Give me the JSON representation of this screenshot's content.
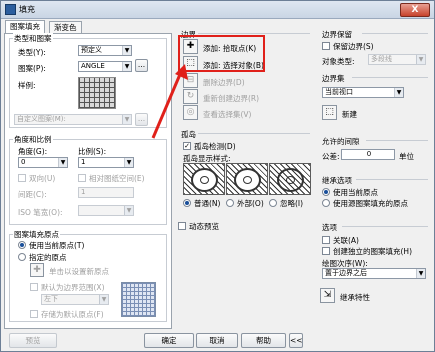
{
  "window": {
    "title": "填充",
    "close_label": "X"
  },
  "tabs": [
    "图案填充",
    "渐变色"
  ],
  "left": {
    "type_group": {
      "title": "类型和图案",
      "type_label": "类型(Y):",
      "type_value": "预定义",
      "pattern_label": "图案(P):",
      "pattern_value": "ANGLE",
      "browse_label": "...",
      "swatch_label": "样例:",
      "custom_label": "自定义图案(M):",
      "custom_browse": "..."
    },
    "angle_group": {
      "title": "角度和比例",
      "angle_label": "角度(G):",
      "angle_value": "0",
      "scale_label": "比例(S):",
      "scale_value": "1",
      "double_label": "双向(U)",
      "relative_label": "相对图纸空间(E)",
      "spacing_label": "间距(C):",
      "spacing_value": "1",
      "iso_label": "ISO 笔宽(O):"
    },
    "origin_group": {
      "title": "图案填充原点",
      "use_current": "使用当前原点(T)",
      "specified": "指定的原点",
      "click_set": "单击以设置新原点",
      "default_extent": "默认为边界范围(X)",
      "extent_value": "左下",
      "store_default": "存储为默认原点(F)"
    }
  },
  "mid": {
    "boundary_title": "边界",
    "pick_points": "添加: 拾取点(K)",
    "select_objects": "添加: 选择对象(B)",
    "remove_boundary": "删除边界(D)",
    "recreate_boundary": "重新创建边界(R)",
    "view_selection": "查看选择集(V)",
    "island_title": "孤岛",
    "island_detect": "孤岛检测(D)",
    "island_style": "孤岛显示样式:",
    "styles": [
      "普通",
      "外部",
      "忽略"
    ],
    "style_keys": [
      "(N)",
      "(O)",
      "(I)"
    ],
    "dynamic_preview": "动态预览"
  },
  "right": {
    "retain_title": "边界保留",
    "retain_label": "保留边界(S)",
    "object_type_label": "对象类型:",
    "object_type_value": "多段线",
    "set_title": "边界集",
    "set_value": "当前视口",
    "new_label": "新建",
    "gap_title": "允许的间隙",
    "tolerance_label": "公差:",
    "tolerance_value": "0",
    "unit_label": "单位",
    "inherit_title": "继承选项",
    "inherit_current": "使用当前原点",
    "inherit_source": "使用源图案填充的原点",
    "options_title": "选项",
    "associative": "关联(A)",
    "separate": "创建独立的图案填充(H)",
    "draw_order_label": "绘图次序(W):",
    "draw_order_value": "置于边界之后",
    "inherit_props": "继承特性"
  },
  "footer": {
    "preview": "预览",
    "ok": "确定",
    "cancel": "取消",
    "help": "帮助",
    "more": "<<"
  },
  "colors": {
    "highlight": "#e0201a",
    "accent": "#1a4f9a"
  }
}
